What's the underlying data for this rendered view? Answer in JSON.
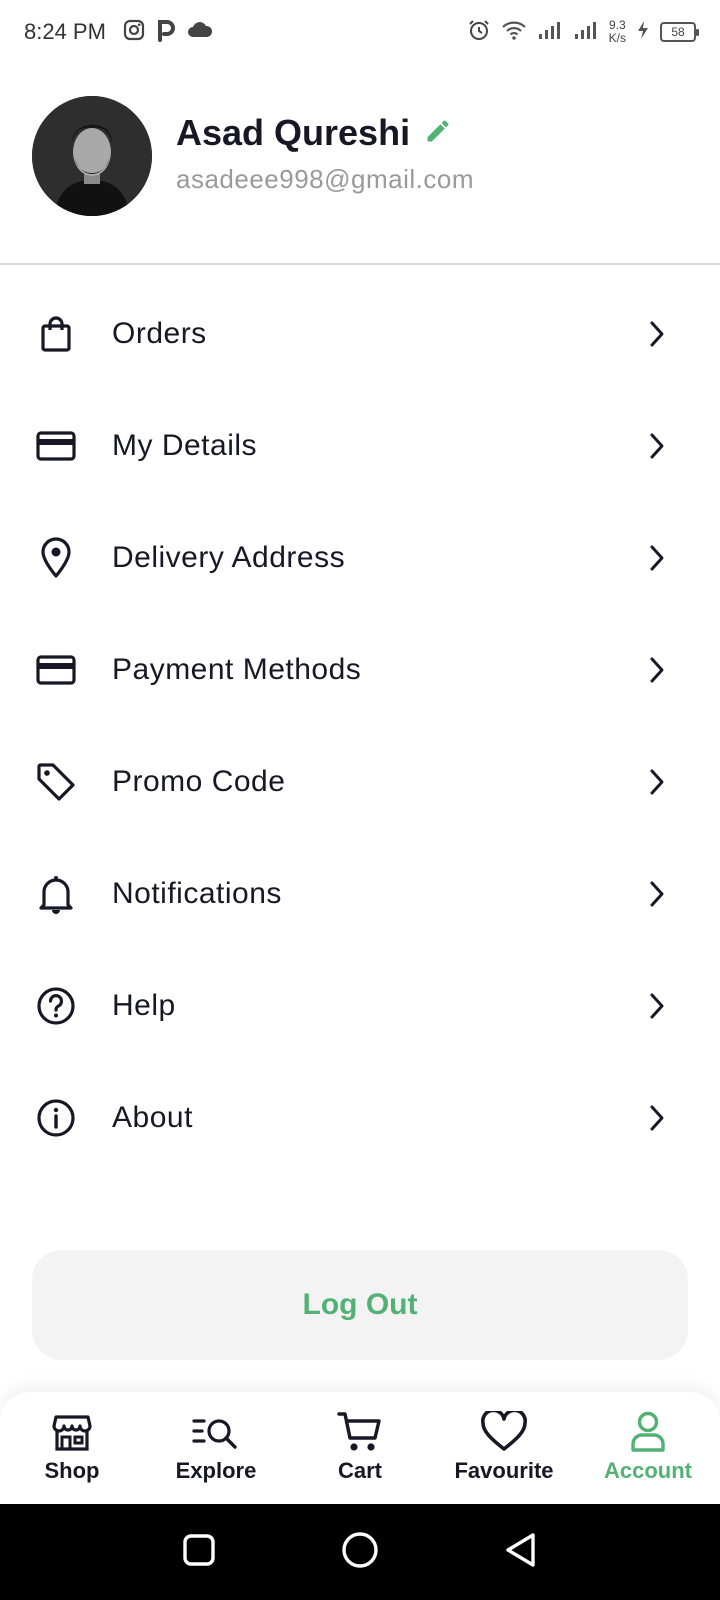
{
  "status_bar": {
    "time": "8:24 PM",
    "net_speed_value": "9.3",
    "net_speed_unit": "K/s",
    "battery": "58"
  },
  "profile": {
    "name": "Asad Qureshi",
    "email": "asadeee998@gmail.com"
  },
  "menu": {
    "items": [
      {
        "label": "Orders",
        "icon": "shopping-bag-icon"
      },
      {
        "label": "My Details",
        "icon": "id-card-icon"
      },
      {
        "label": "Delivery Address",
        "icon": "location-pin-icon"
      },
      {
        "label": "Payment Methods",
        "icon": "credit-card-icon"
      },
      {
        "label": "Promo Code",
        "icon": "tag-icon"
      },
      {
        "label": "Notifications",
        "icon": "bell-icon"
      },
      {
        "label": "Help",
        "icon": "help-circle-icon"
      },
      {
        "label": "About",
        "icon": "info-circle-icon"
      }
    ]
  },
  "logout_label": "Log Out",
  "bottom_nav": {
    "items": [
      {
        "label": "Shop",
        "icon": "store-icon",
        "active": false
      },
      {
        "label": "Explore",
        "icon": "explore-search-icon",
        "active": false
      },
      {
        "label": "Cart",
        "icon": "cart-icon",
        "active": false
      },
      {
        "label": "Favourite",
        "icon": "heart-icon",
        "active": false
      },
      {
        "label": "Account",
        "icon": "user-icon",
        "active": true
      }
    ]
  },
  "colors": {
    "accent": "#53B175",
    "text": "#181725",
    "muted": "#9A9A9A",
    "button_bg": "#F2F3F2"
  }
}
